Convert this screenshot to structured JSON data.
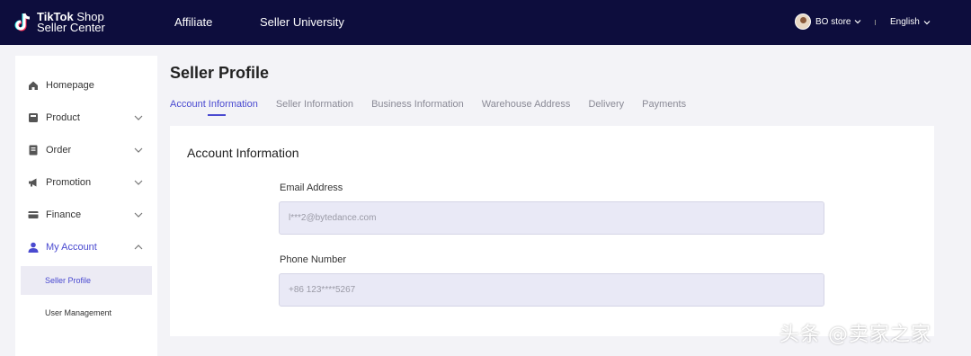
{
  "header": {
    "logo_line1_bold": "TikTok",
    "logo_line1_rest": " Shop",
    "logo_line2": "Seller Center",
    "nav": [
      "Affiliate",
      "Seller University"
    ],
    "store_name": "BO store",
    "language": "English",
    "background_color": "#0d0d3d"
  },
  "sidebar": {
    "items": [
      {
        "label": "Homepage",
        "icon": "home-icon"
      },
      {
        "label": "Product",
        "icon": "product-icon"
      },
      {
        "label": "Order",
        "icon": "order-icon"
      },
      {
        "label": "Promotion",
        "icon": "megaphone-icon"
      },
      {
        "label": "Finance",
        "icon": "card-icon"
      },
      {
        "label": "My Account",
        "icon": "user-icon"
      }
    ],
    "sub_items": [
      "Seller Profile",
      "User Management"
    ],
    "accent_color": "#4a4ad0"
  },
  "main": {
    "title": "Seller Profile",
    "tabs": [
      "Account Information",
      "Seller Information",
      "Business Information",
      "Warehouse Address",
      "Delivery",
      "Payments"
    ],
    "active_tab": "Account Information",
    "card_title": "Account Information",
    "email_label": "Email Address",
    "email_value": "l***2@bytedance.com",
    "phone_label": "Phone Number",
    "phone_value": "+86 123****5267"
  },
  "watermark": "头条 @卖家之家"
}
